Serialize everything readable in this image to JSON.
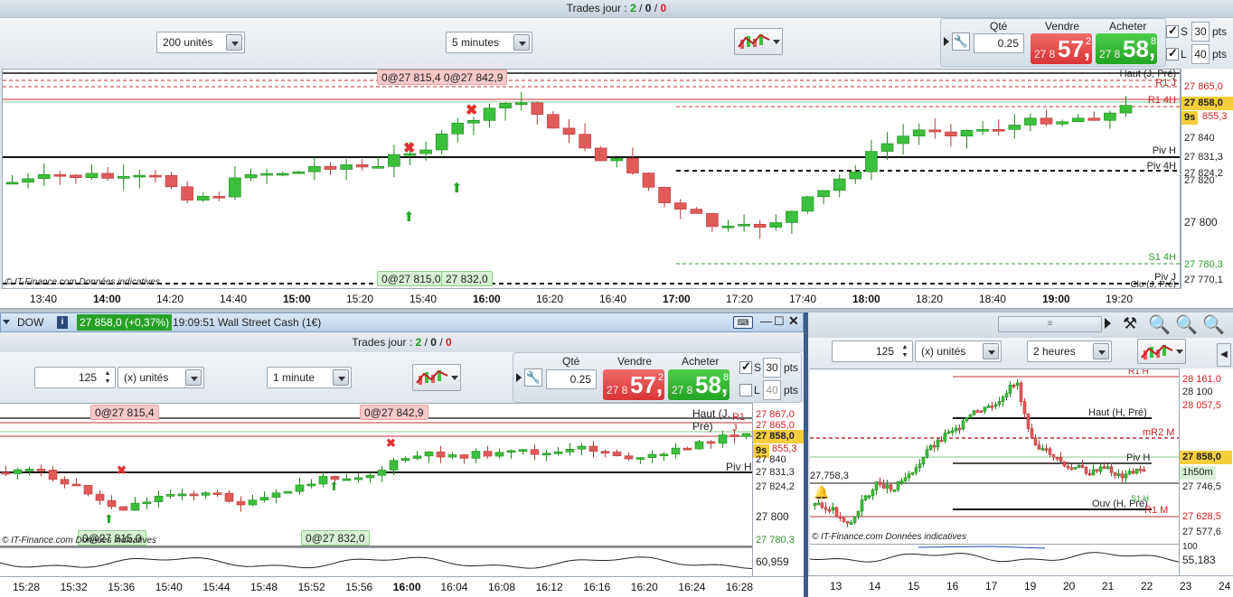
{
  "top": {
    "trades_label": "Trades jour :",
    "trades_a": "2",
    "trades_sep1": "/",
    "trades_b": "0",
    "trades_sep2": "/",
    "trades_c": "0",
    "size_select": "200 unités",
    "interval_select": "5 minutes",
    "qty_label": "Qté",
    "qty_value": "0.25",
    "sell_label": "Vendre",
    "buy_label": "Acheter",
    "sell_pre": "27 8",
    "sell_big": "57,",
    "sell_sup": "2",
    "buy_pre": "27 8",
    "buy_big": "58,",
    "buy_sup": "8",
    "s_label": "S",
    "s_value": "30",
    "s_unit": "pts",
    "l_label": "L",
    "l_value": "40",
    "l_unit": "pts",
    "order_tag_top": "0@27 815,4 0@27 842,9",
    "order_tag_bot1": "0@27 815,0",
    "order_tag_bot2": "27 832,0",
    "level_labels": [
      "Haut (J, Pré)",
      "R1 J",
      "R1 4H",
      "Piv H",
      "Piv 4H",
      "S1 4H",
      "Piv J",
      "Clo (J, Pré)"
    ],
    "price_ticks": [
      "27 865,0",
      "27 858,0",
      "855,3",
      "27 840",
      "27 831,3",
      "27 824,2",
      "27 820",
      "27 800",
      "27 780,3",
      "27 770,1"
    ],
    "timer": "9s",
    "watermark": "© IT-Finance.com  Données indicatives",
    "time_ticks": [
      "13:40",
      "14:00",
      "14:20",
      "14:40",
      "15:00",
      "15:20",
      "15:40",
      "16:00",
      "16:20",
      "16:40",
      "17:00",
      "17:20",
      "17:40",
      "18:00",
      "18:20",
      "18:40",
      "19:00",
      "19:20"
    ],
    "time_bold": [
      "14:00",
      "15:00",
      "16:00",
      "17:00",
      "18:00",
      "19:00"
    ]
  },
  "window": {
    "instrument": "DOW",
    "price_badge": "27 858,0 (+0,37%)",
    "time_name": "19:09:51 Wall Street Cash (1€)"
  },
  "bl": {
    "trades_label": "Trades jour :",
    "trades_a": "2",
    "trades_sep1": "/",
    "trades_b": "0",
    "trades_sep2": "/",
    "trades_c": "0",
    "qty_spin": "125",
    "units_select": "(x) unités",
    "interval_select": "1 minute",
    "qty_label": "Qté",
    "qty_value": "0.25",
    "sell_label": "Vendre",
    "buy_label": "Acheter",
    "sell_pre": "27 8",
    "sell_big": "57,",
    "sell_sup": "2",
    "buy_pre": "27 8",
    "buy_big": "58,",
    "buy_sup": "8",
    "s_label": "S",
    "s_value": "30",
    "s_unit": "pts",
    "l_label": "L",
    "l_value": "40",
    "l_unit": "pts",
    "tag1": "0@27 815,4",
    "tag2": "0@27 842,9",
    "tag3": "0@27 815,0",
    "tag4": "0@27 832,0",
    "level_labels": [
      "Haut (J, Pré)",
      "R1 J",
      "Piv H"
    ],
    "price_ticks": [
      "27 867,0",
      "27 865,0",
      "27 858,0",
      "855,3",
      "27 840",
      "27 831,3",
      "27 824,2",
      "27 800",
      "27 780,3"
    ],
    "timer": "9s",
    "watermark": "© IT-Finance.com  Données indicatives",
    "osc_value": "60,959",
    "time_ticks": [
      "15:28",
      "15:32",
      "15:36",
      "15:40",
      "15:44",
      "15:48",
      "15:52",
      "15:56",
      "16:00",
      "16:04",
      "16:08",
      "16:12",
      "16:16",
      "16:20",
      "16:24",
      "16:28"
    ],
    "time_bold": [
      "16:00"
    ]
  },
  "br": {
    "qty_spin": "125",
    "units_select": "(x) unités",
    "interval_select": "2 heures",
    "start_label": "27,758,3",
    "level_labels": [
      "R1 H",
      "Haut (H, Pré)",
      "mR2 M",
      "Piv H",
      "Ouv (H, Pré)",
      "S1 H",
      "R1 M"
    ],
    "price_ticks": [
      "28 161,0",
      "28 100",
      "28 057,5",
      "27 858,0",
      "27 746,5",
      "27 628,5",
      "27 577,6"
    ],
    "timer": "1h50m",
    "watermark": "© IT-Finance.com  Données indicatives",
    "osc_value": "55,183",
    "osc_top": "100",
    "time_ticks": [
      "13",
      "14",
      "15",
      "16",
      "17",
      "19",
      "20",
      "21",
      "22",
      "23",
      "24"
    ]
  },
  "colors": {
    "up": "#3cbf3c",
    "down": "#e05a5a",
    "accent_bar": "#cfe0f2",
    "price_highlight": "#f6cd3c"
  }
}
